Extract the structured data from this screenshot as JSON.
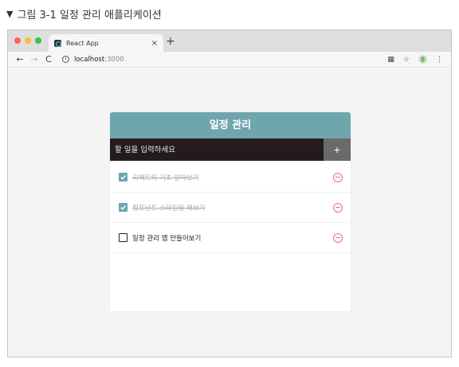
{
  "caption": {
    "marker": "▼",
    "text": "그림 3-1 일정 관리 애플리케이션"
  },
  "browser": {
    "tab_title": "React App",
    "tab_close": "×",
    "new_tab": "+",
    "nav": {
      "back": "←",
      "forward": "→",
      "reload": "C"
    },
    "url_host": "localhost",
    "url_port": ":3000",
    "menu": "⋮"
  },
  "app": {
    "title": "일정 관리",
    "input_placeholder": "할 일을 입력하세요",
    "add_label": "+",
    "todos": [
      {
        "text": "리액트의 기초 알아보기",
        "checked": true
      },
      {
        "text": "컴포넌트 스타일링 해보기",
        "checked": true
      },
      {
        "text": "일정 관리 앱 만들어보기",
        "checked": false
      }
    ]
  },
  "colors": {
    "header": "#6fa5ac",
    "insert_bg": "#241b1c",
    "remove": "#e8706f"
  }
}
